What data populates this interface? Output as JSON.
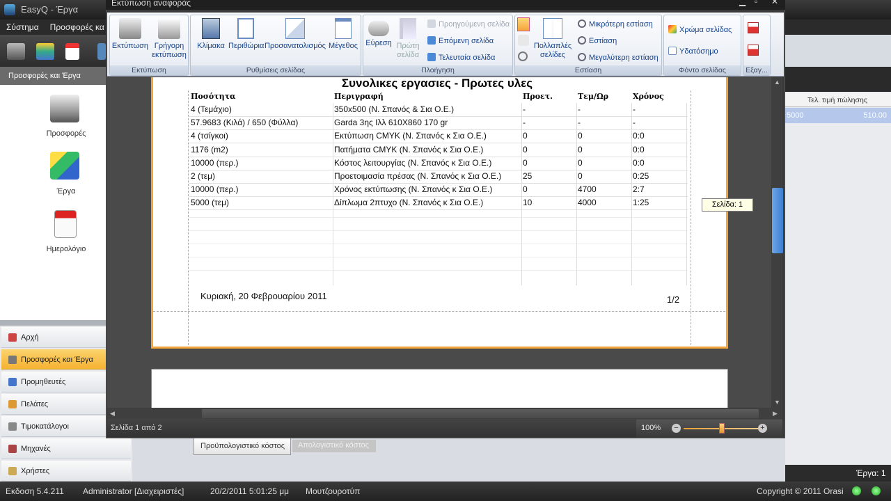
{
  "main_window": {
    "title": "EasyQ - Έργα",
    "menu": [
      "Σύστημα",
      "Προσφορές κα"
    ],
    "left_header": "Προσφορές και Έργα",
    "nav_icons": [
      {
        "label": "Προσφορές",
        "icon": "cash-register-icon"
      },
      {
        "label": "Έργα",
        "icon": "projects-icon"
      },
      {
        "label": "Ημερολόγιο",
        "icon": "calendar-icon"
      }
    ],
    "nav_buttons": [
      {
        "label": "Αρχή",
        "icon": "home-icon",
        "active": false
      },
      {
        "label": "Προσφορές και Έργα",
        "icon": "offers-icon",
        "active": true
      },
      {
        "label": "Προμηθευτές",
        "icon": "suppliers-icon",
        "active": false
      },
      {
        "label": "Πελάτες",
        "icon": "customers-icon",
        "active": false
      },
      {
        "label": "Τιμοκατάλογοι",
        "icon": "pricelists-icon",
        "active": false
      },
      {
        "label": "Μηχανές",
        "icon": "machines-icon",
        "active": false
      },
      {
        "label": "Χρήστες",
        "icon": "users-icon",
        "active": false
      }
    ],
    "right_grid": {
      "header": "Τελ. τιμή πώλησης",
      "row_left": "5000",
      "row_value": "510.00"
    },
    "right_bottom": "Έργα: 1",
    "bottom_tabs": {
      "budget": "Προϋπολογιστικό κόστος",
      "final": "Απολογιστικό κόστος"
    }
  },
  "status_bar": {
    "version": "Εκδοση  5.4.211",
    "user": "Administrator [Διαχειριστές]",
    "datetime": "20/2/2011 5:01:25 μμ",
    "company": "Μουτζουροτύπ",
    "copyright": "Copyright © 2011 Orasi"
  },
  "preview": {
    "title": "Εκτύπωση αναφοράς",
    "ribbon": {
      "print_group": {
        "label": "Εκτύπωση",
        "print": "Εκτύπωση",
        "quick_print": "Γρήγορη εκτύπωση"
      },
      "page_setup_group": {
        "label": "Ρυθμίσεις σελίδας",
        "scale": "Κλίμακα",
        "margins": "Περιθώρια",
        "orientation": "Προσανατολισμός",
        "size": "Μέγεθος"
      },
      "navigation_group": {
        "label": "Πλοήγηση",
        "find": "Εύρεση",
        "first_page": "Πρώτη σελίδα",
        "previous_page": "Προηγούμενη σελίδα",
        "next_page": "Επόμενη σελίδα",
        "last_page": "Τελευταία σελίδα"
      },
      "zoom_group": {
        "label": "Εστίαση",
        "multiple_pages": "Πολλαπλές σελίδες",
        "zoom_out": "Μικρότερη εστίαση",
        "zoom": "Εστίαση",
        "zoom_in": "Μεγαλύτερη εστίαση"
      },
      "background_group": {
        "label": "Φόντο σελίδας",
        "page_color": "Χρώμα σελίδας",
        "watermark": "Υδατόσημο"
      },
      "export_group": {
        "label": "Εξαγ..."
      }
    },
    "report": {
      "title": "Συνολικες εργασιες - Πρωτες υλες",
      "columns": [
        "Ποσότητα",
        "Περιγραφή",
        "Προετ.",
        "Τεμ/Ωρ",
        "Χρόνος"
      ],
      "rows": [
        [
          "4 (Τεμάχιο)",
          "350x500 (Ν. Σπανός & Σια Ο.Ε.)",
          "-",
          "-",
          "-"
        ],
        [
          "57.9683 (Κιλά) / 650 (Φύλλα)",
          "Garda 3ης Ιλλ 610Χ860 170 gr",
          "-",
          "-",
          "-"
        ],
        [
          "4 (τσίγκοι)",
          "Εκτύπωση CMYK (Ν. Σπανός κ Σια Ο.Ε.)",
          "0",
          "0",
          "0:0"
        ],
        [
          "1176 (m2)",
          "Πατήματα CMYK (Ν. Σπανός κ Σια Ο.Ε.)",
          "0",
          "0",
          "0:0"
        ],
        [
          "10000 (περ.)",
          "Κόστος λειτουργίας (Ν. Σπανός κ Σια Ο.Ε.)",
          "0",
          "0",
          "0:0"
        ],
        [
          "2 (τεμ)",
          "Προετοιμασία πρέσας (Ν. Σπανός κ Σια Ο.Ε.)",
          "25",
          "0",
          "0:25"
        ],
        [
          "10000 (περ.)",
          "Χρόνος εκτύπωσης (Ν. Σπανός κ Σια Ο.Ε.)",
          "0",
          "4700",
          "2:7"
        ],
        [
          "5000 (τεμ)",
          "Δίπλωμα 2πτυχο (Ν. Σπανός κ Σια Ο.Ε.)",
          "10",
          "4000",
          "1:25"
        ]
      ],
      "footer_date": "Κυριακή, 20 Φεβρουαρίου 2011",
      "footer_page": "1/2"
    },
    "tooltip": "Σελίδα: 1",
    "status_page": "Σελίδα 1 από 2",
    "zoom": "100%",
    "zoom_fraction": 0.5
  }
}
